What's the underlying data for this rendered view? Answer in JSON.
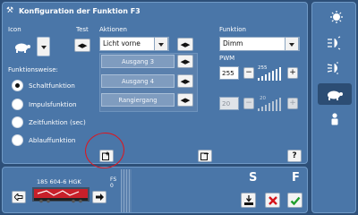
{
  "dialog": {
    "title": "Konfiguration der Funktion F3"
  },
  "left": {
    "icon_label": "Icon",
    "test_label": "Test",
    "mode_label": "Funktionsweise:",
    "modes": [
      {
        "label": "Schaltfunktion",
        "selected": true
      },
      {
        "label": "Impulsfunktion",
        "selected": false
      },
      {
        "label": "Zeitfunktion (sec)",
        "selected": false
      },
      {
        "label": "Ablauffunktion",
        "selected": false
      }
    ]
  },
  "actions": {
    "label": "Aktionen",
    "selected_action": "Licht vorne",
    "items": [
      "Ausgang 3",
      "Ausgang 4",
      "Rangiergang"
    ]
  },
  "function": {
    "label": "Funktion",
    "selected": "Dimm",
    "pwm_label": "PWM",
    "pwm_value": "255",
    "pwm_max": "255",
    "second_value": "20",
    "second_max": "20"
  },
  "bottom": {
    "loco_name": "185 604-6 HGK",
    "fs_label": "FS",
    "fs_value": "0",
    "s_label": "S",
    "f_label": "F"
  },
  "sidebar": {
    "items": [
      {
        "icon": "light-icon"
      },
      {
        "icon": "headlight-left-icon"
      },
      {
        "icon": "headlight-right-icon"
      },
      {
        "icon": "turtle-icon",
        "active": true
      },
      {
        "icon": "person-icon"
      }
    ]
  },
  "colors": {
    "accent": "#4a76a8",
    "background": "#2d4f78",
    "annotation": "#e0141c"
  }
}
